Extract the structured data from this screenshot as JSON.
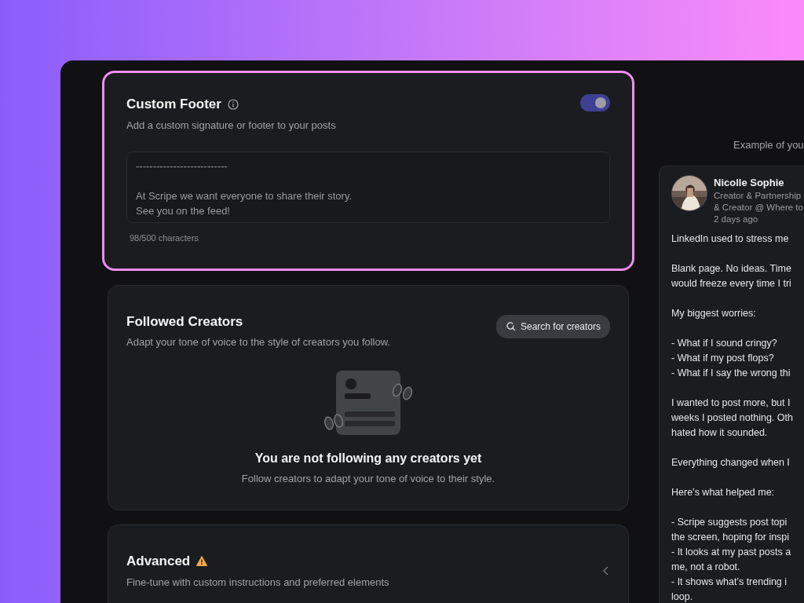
{
  "custom_footer": {
    "title": "Custom Footer",
    "subtitle": "Add a custom signature or footer to your posts",
    "enabled": true,
    "highlighted": true,
    "value": "---------------------------\n\nAt Scripe we want everyone to share their story.\nSee you on the feed!",
    "counter": "98/500 characters"
  },
  "followed_creators": {
    "title": "Followed Creators",
    "subtitle": "Adapt your tone of voice to the style of creators you follow.",
    "button": "Search for creators",
    "empty_title": "You are not following any creators yet",
    "empty_text": "Follow creators to adapt your tone of voice to their style."
  },
  "advanced": {
    "title": "Advanced",
    "subtitle": "Fine-tune with custom instructions and preferred elements",
    "warning": true,
    "expanded": false
  },
  "preview": {
    "heading": "Example of you",
    "post": {
      "author": "Nicolle Sophie",
      "headline": [
        "Creator & Partnership",
        "& Creator @ Where to"
      ],
      "time": "2 days ago",
      "paragraphs": [
        [
          "LinkedIn used to stress me"
        ],
        [
          "Blank page. No ideas. Time",
          "would freeze every time I tri"
        ],
        [
          "My biggest worries:"
        ],
        [
          "- What if I sound cringy?",
          "- What if my post flops?",
          "- What if I say the wrong thi"
        ],
        [
          "I wanted to post more, but I",
          "weeks I posted nothing. Oth",
          "hated how it sounded."
        ],
        [
          "Everything changed when I"
        ],
        [
          "Here’s what helped me:"
        ],
        [
          "- Scripe suggests post topi",
          "the screen, hoping for inspi",
          "- It looks at my past posts a",
          "me, not a robot.",
          "- It shows what’s trending i",
          "loop."
        ]
      ]
    }
  }
}
